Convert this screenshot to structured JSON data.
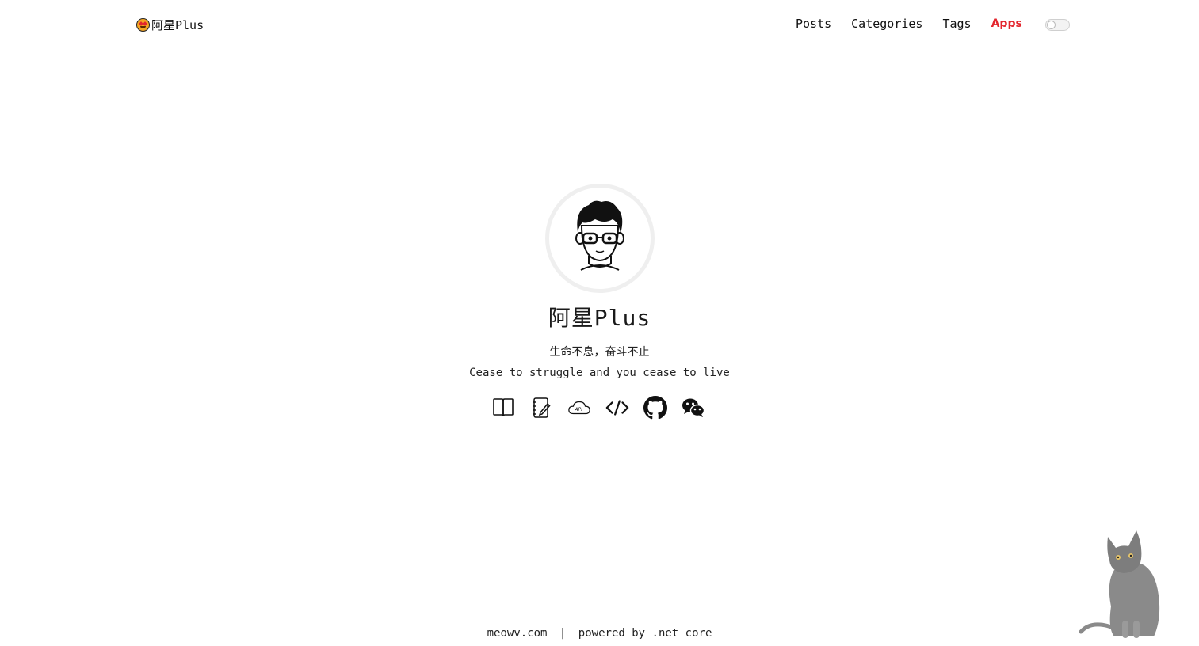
{
  "brand": {
    "name": "阿星Plus",
    "icon": "star-struck-emoji-icon"
  },
  "nav": {
    "items": [
      {
        "label": "Posts",
        "active": false
      },
      {
        "label": "Categories",
        "active": false
      },
      {
        "label": "Tags",
        "active": false
      },
      {
        "label": "Apps",
        "active": true
      }
    ],
    "active_color": "#e3262e",
    "theme_toggle": {
      "state": "off"
    }
  },
  "profile": {
    "title": "阿星Plus",
    "motto_cn": "生命不息，奋斗不止",
    "motto_en": "Cease to struggle and you cease to live",
    "links": [
      {
        "icon": "book-icon"
      },
      {
        "icon": "notebook-icon"
      },
      {
        "icon": "api-cloud-icon"
      },
      {
        "icon": "code-icon"
      },
      {
        "icon": "github-icon"
      },
      {
        "icon": "wechat-icon"
      }
    ]
  },
  "footer": {
    "site": "meowv.com",
    "separator": "|",
    "powered": "powered by .net core"
  },
  "colors": {
    "background": "#ffffff",
    "text": "#1a1a1a",
    "accent": "#e3262e",
    "cat": "#8a8a8a"
  }
}
